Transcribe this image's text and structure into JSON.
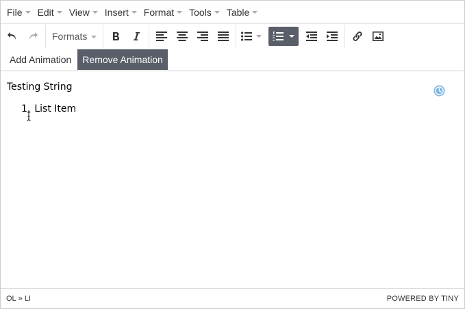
{
  "menubar": {
    "items": [
      {
        "label": "File"
      },
      {
        "label": "Edit"
      },
      {
        "label": "View"
      },
      {
        "label": "Insert"
      },
      {
        "label": "Format"
      },
      {
        "label": "Tools"
      },
      {
        "label": "Table"
      }
    ]
  },
  "toolbar": {
    "formats_label": "Formats"
  },
  "toolbar2": {
    "add_animation_label": "Add Animation",
    "remove_animation_label": "Remove Animation"
  },
  "content": {
    "paragraph": "Testing String",
    "list_number": "1.",
    "list_item": "List Item"
  },
  "statusbar": {
    "path_ol": "OL",
    "path_sep": "»",
    "path_li": "LI",
    "branding": "POWERED BY TINY"
  },
  "colors": {
    "active_bg": "#595e68",
    "clock_icon": "#7fb5e0",
    "border": "#cccccc"
  },
  "icons": [
    "undo-icon",
    "redo-icon",
    "bold-icon",
    "italic-icon",
    "align-left-icon",
    "align-center-icon",
    "align-right-icon",
    "align-justify-icon",
    "bullet-list-icon",
    "numbered-list-icon",
    "outdent-icon",
    "indent-icon",
    "link-icon",
    "image-icon",
    "clock-icon",
    "text-cursor-icon"
  ]
}
